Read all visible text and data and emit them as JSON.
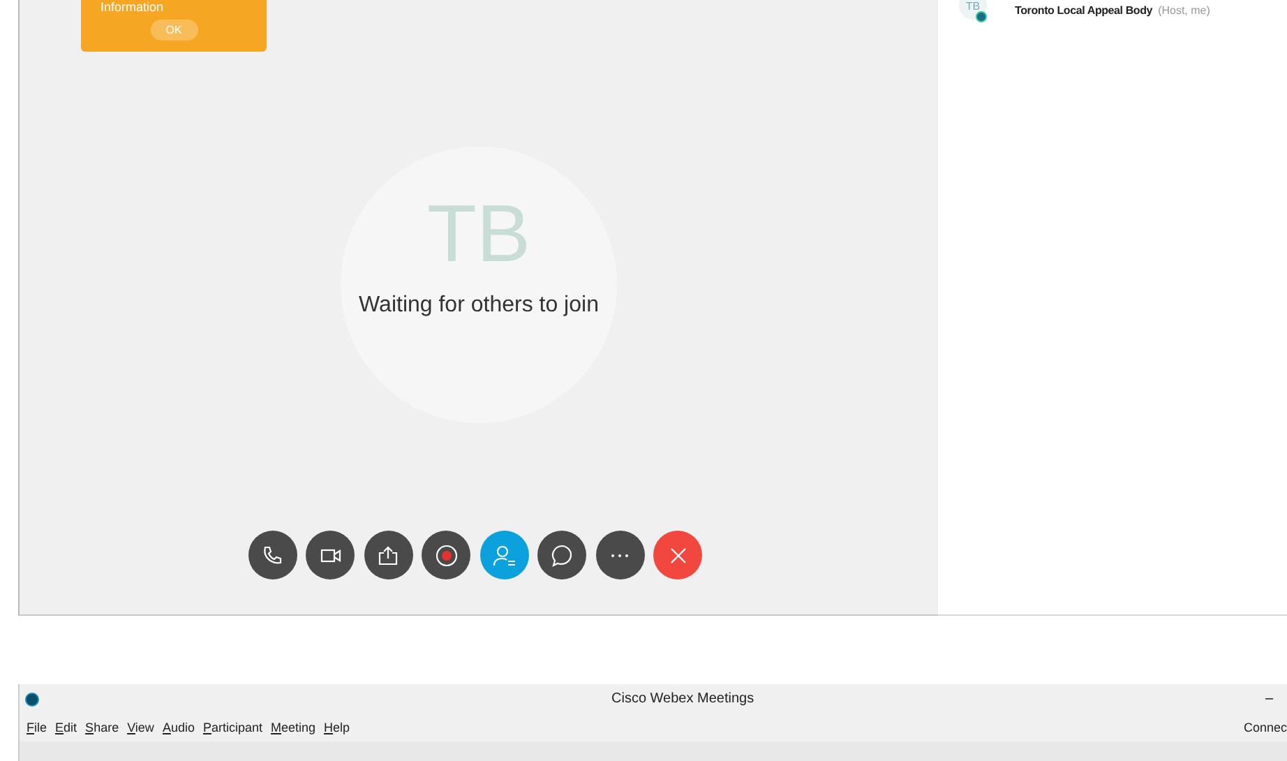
{
  "notice": {
    "text": "Information",
    "button": "OK"
  },
  "stage": {
    "avatar_initials": "TB",
    "message": "Waiting for others to join"
  },
  "controls": [
    {
      "kind": "audio",
      "active": false
    },
    {
      "kind": "video",
      "active": false
    },
    {
      "kind": "share",
      "active": false
    },
    {
      "kind": "record",
      "active": false
    },
    {
      "kind": "participants",
      "active": true
    },
    {
      "kind": "chat",
      "active": false
    },
    {
      "kind": "more",
      "active": false
    },
    {
      "kind": "leave",
      "active": false
    }
  ],
  "participants": [
    {
      "initials": "TB",
      "name": "Toronto Local Appeal Body",
      "role": "(Host, me)"
    }
  ],
  "window": {
    "title": "Cisco Webex Meetings",
    "minimize": "–",
    "status": "Connec"
  },
  "menu": [
    "File",
    "Edit",
    "Share",
    "View",
    "Audio",
    "Participant",
    "Meeting",
    "Help"
  ]
}
